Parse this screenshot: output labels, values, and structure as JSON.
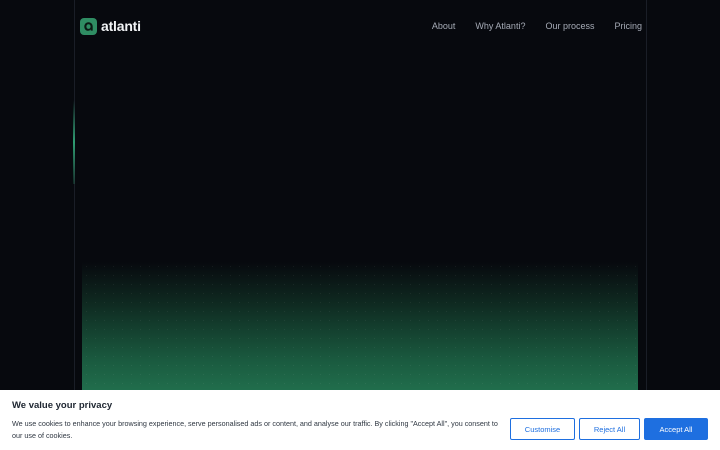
{
  "brand": {
    "name": "atlanti",
    "accent": "#2f8d63"
  },
  "nav": [
    {
      "label": "About"
    },
    {
      "label": "Why Atlanti?"
    },
    {
      "label": "Our process"
    },
    {
      "label": "Pricing"
    }
  ],
  "cookie": {
    "title": "We value your privacy",
    "text": "We use cookies to enhance your browsing experience, serve personalised ads or content, and analyse our traffic. By clicking \"Accept All\", you consent to our use of cookies.",
    "customise_label": "Customise",
    "reject_label": "Reject All",
    "accept_label": "Accept All",
    "button_color": "#1e6fe0"
  }
}
